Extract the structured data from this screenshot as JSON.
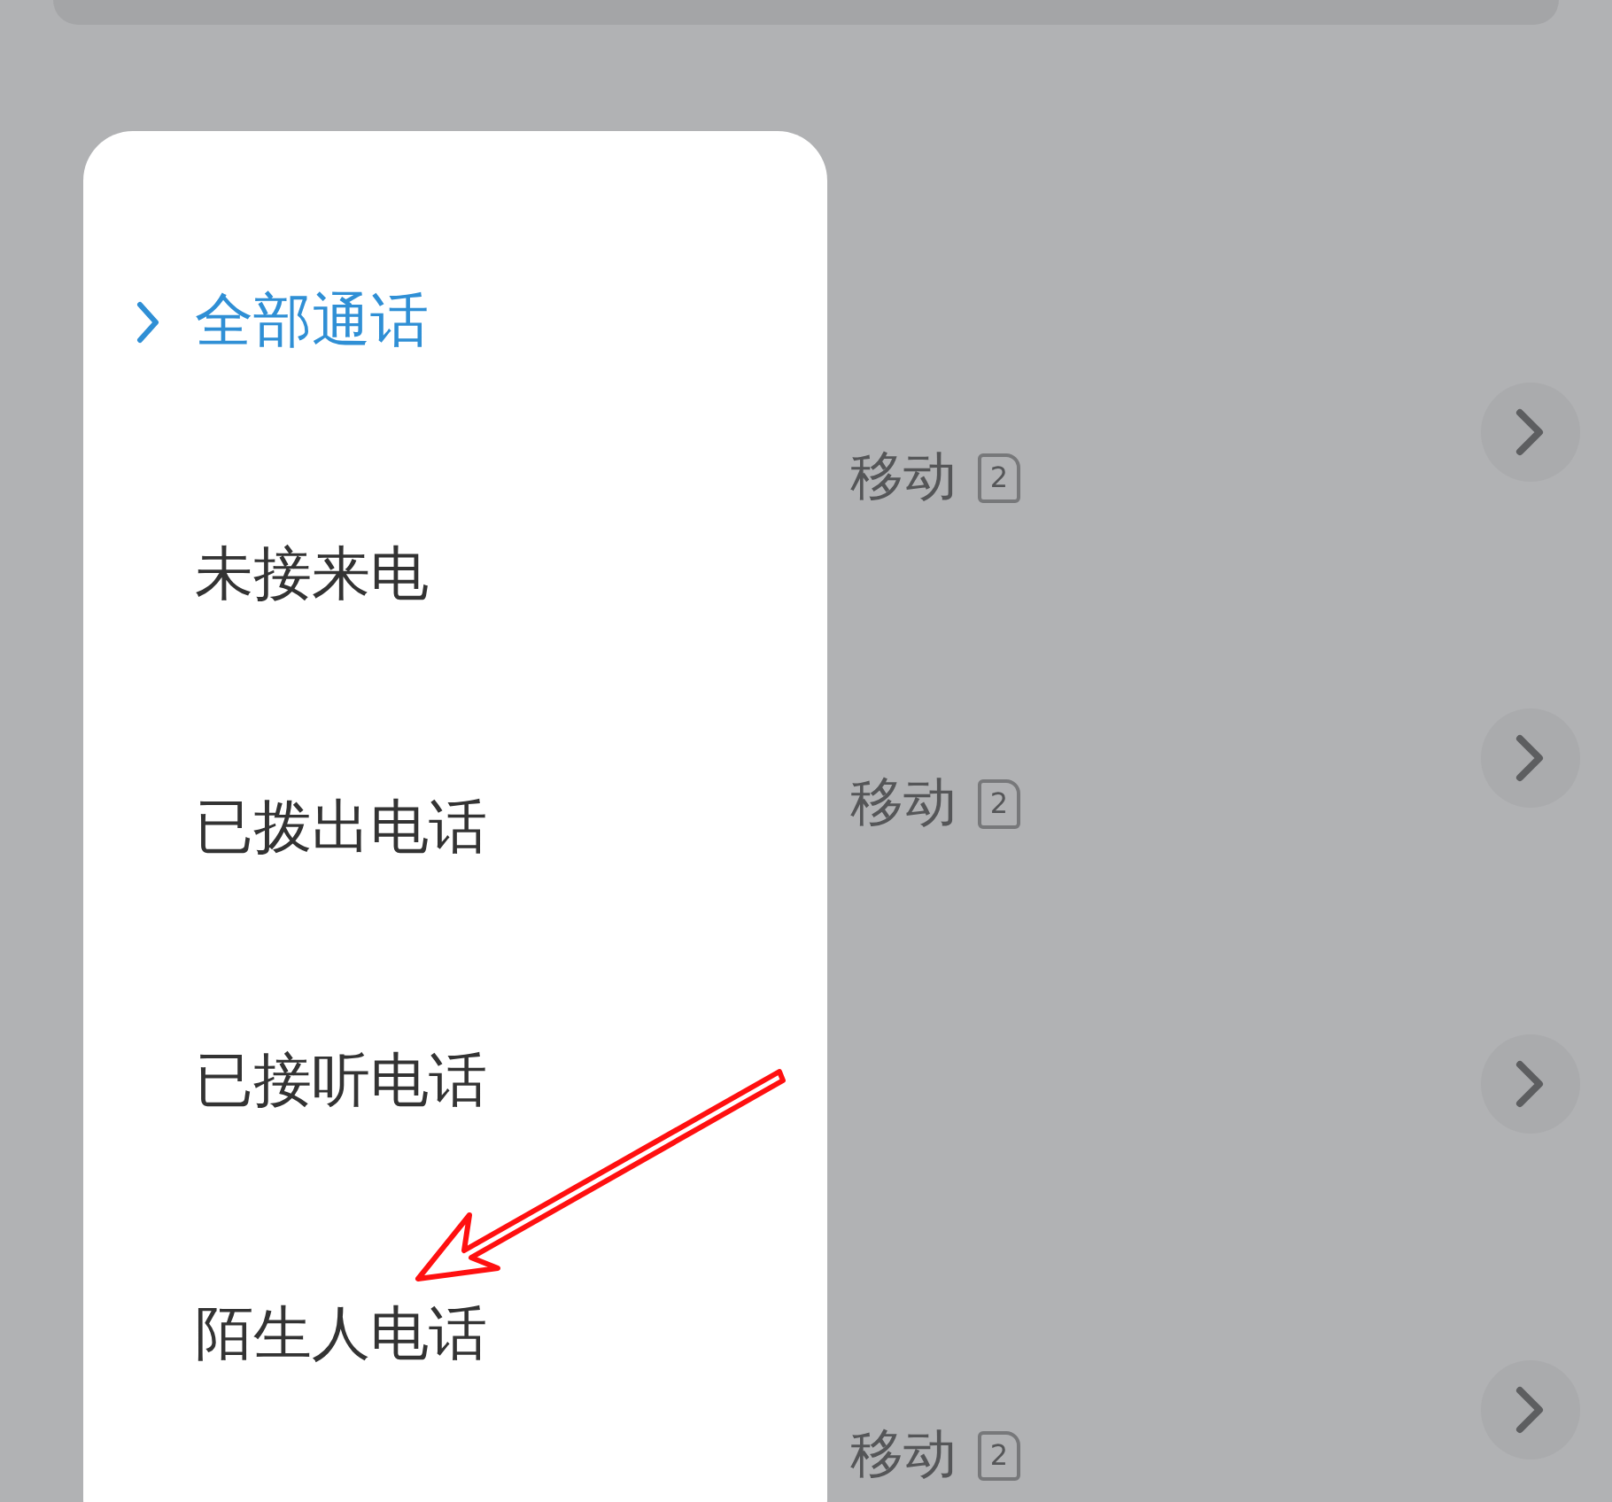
{
  "call_rows": [
    {
      "kind": "carrier",
      "carrier": "移动",
      "sim": "2"
    },
    {
      "kind": "carrier",
      "carrier": "移动",
      "sim": "2"
    },
    {
      "kind": "blank"
    },
    {
      "kind": "carrier",
      "carrier": "移动",
      "sim": "2"
    }
  ],
  "filter_menu": {
    "items": [
      {
        "label": "全部通话",
        "selected": true
      },
      {
        "label": "未接来电",
        "selected": false
      },
      {
        "label": "已拨出电话",
        "selected": false
      },
      {
        "label": "已接听电话",
        "selected": false
      },
      {
        "label": "陌生人电话",
        "selected": false
      }
    ]
  }
}
